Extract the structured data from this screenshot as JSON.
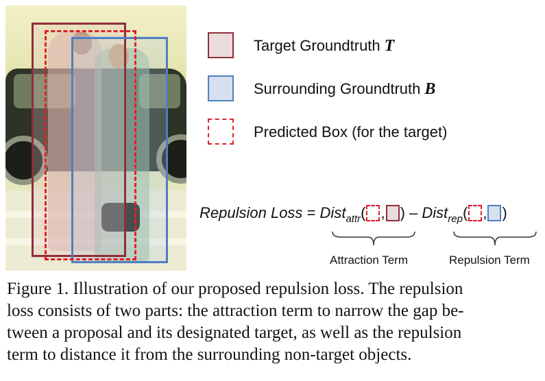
{
  "legend": {
    "items": [
      {
        "label": "Target Groundtruth",
        "symbol": "T",
        "color": "#8e2e3a"
      },
      {
        "label": "Surrounding Groundtruth",
        "symbol": "B",
        "color": "#4f7fc2"
      },
      {
        "label": "Predicted Box (for the target)",
        "symbol": "",
        "color": "#e0202a"
      }
    ]
  },
  "equation": {
    "lhs": "Repulsion Loss",
    "equals": "=",
    "dist": "Dist",
    "sub_attr": "attr",
    "sub_rep": "rep",
    "minus": "–",
    "open_paren": "(",
    "close_paren": ")",
    "comma": ",",
    "attraction_label": "Attraction Term",
    "repulsion_label": "Repulsion Term"
  },
  "caption": {
    "lines": [
      "Figure 1. Illustration of our proposed repulsion loss. The repulsion",
      "loss consists of two parts: the attraction term to narrow the gap be-",
      "tween a proposal and its designated target, as well as the repulsion",
      "term to distance it from the surrounding non-target objects."
    ]
  }
}
